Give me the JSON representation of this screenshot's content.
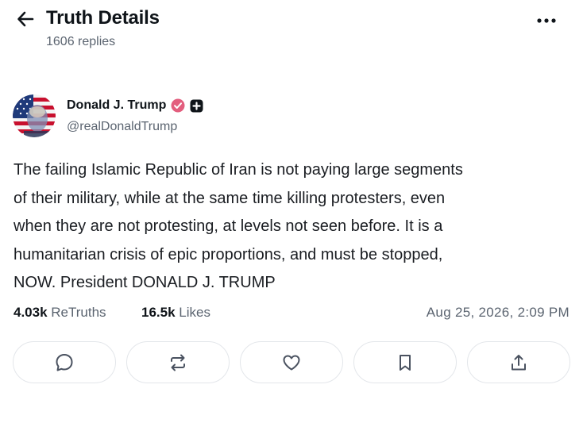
{
  "header": {
    "title": "Truth Details",
    "reply_count": "1606 replies",
    "back_icon": "arrow-left-icon",
    "more_icon": "more-horizontal-icon"
  },
  "author": {
    "display_name": "Donald J. Trump",
    "handle": "@realDonaldTrump",
    "verified_badge_color": "#e35e7e",
    "badges": [
      "verified-badge-icon",
      "plus-badge-icon"
    ]
  },
  "post": {
    "lines": [
      "The failing Islamic Republic of Iran is not paying large segments",
      "of their military, while at the same time killing protesters, even",
      "when they are not protesting, at levels not seen before. It is a",
      "humanitarian crisis of epic proportions, and must be stopped,",
      "NOW. President DONALD J. TRUMP"
    ]
  },
  "stats": {
    "retruths_count": "4.03k",
    "retruths_label": "ReTruths",
    "likes_count": "16.5k",
    "likes_label": "Likes",
    "timestamp": "Aug 25, 2026, 2:09 PM"
  },
  "actions": [
    {
      "name": "reply",
      "icon": "comment-icon"
    },
    {
      "name": "retruth",
      "icon": "repost-icon"
    },
    {
      "name": "like",
      "icon": "heart-icon"
    },
    {
      "name": "bookmark",
      "icon": "bookmark-icon"
    },
    {
      "name": "share",
      "icon": "share-icon"
    }
  ],
  "colors": {
    "text": "#0f1419",
    "secondary": "#5b6470",
    "border": "#e3e6ea"
  }
}
